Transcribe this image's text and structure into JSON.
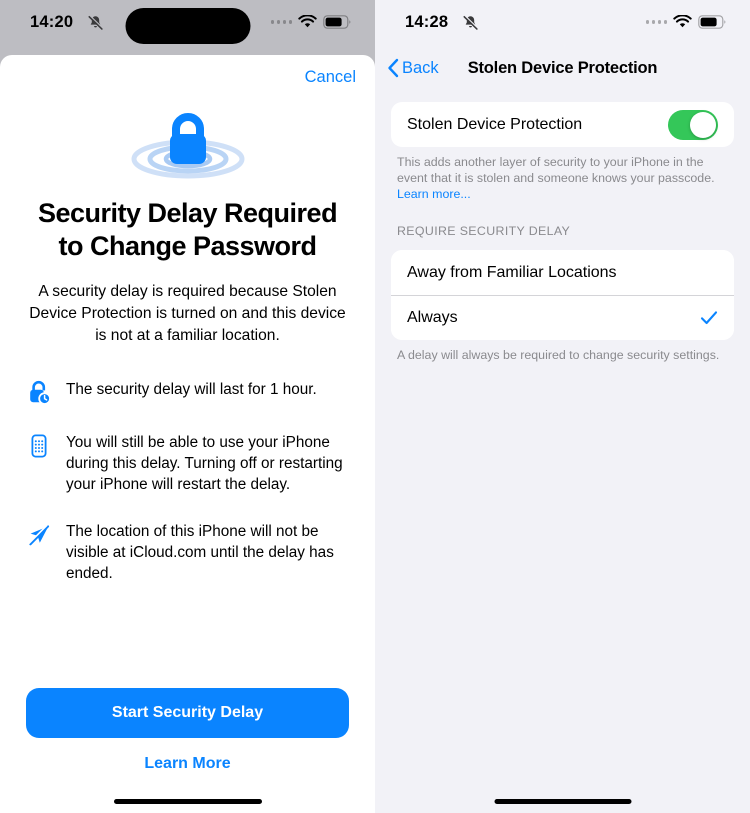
{
  "left": {
    "status": {
      "time": "14:20",
      "bell_icon": "bell-slash-icon",
      "wifi_icon": "wifi-icon",
      "battery_icon": "battery-icon"
    },
    "cancel_label": "Cancel",
    "hero_icon": "lock-ripple-icon",
    "title": "Security Delay Required to Change Password",
    "subtitle": "A security delay is required because Stolen Device Protection is turned on and this device is not at a familiar location.",
    "bullets": [
      {
        "icon": "lock-clock-icon",
        "text": "The security delay will last for 1 hour."
      },
      {
        "icon": "iphone-keypad-icon",
        "text": "You will still be able to use your iPhone during this delay. Turning off or restarting your iPhone will restart the delay."
      },
      {
        "icon": "location-slash-icon",
        "text": "The location of this iPhone will not be visible at iCloud.com until the delay has ended."
      }
    ],
    "primary_label": "Start Security Delay",
    "learn_more_label": "Learn More"
  },
  "right": {
    "status": {
      "time": "14:28",
      "bell_icon": "bell-slash-icon",
      "wifi_icon": "wifi-icon",
      "battery_icon": "battery-icon"
    },
    "back_label": "Back",
    "nav_title": "Stolen Device Protection",
    "toggle_row": {
      "label": "Stolen Device Protection",
      "state": "on"
    },
    "toggle_footnote": "This adds another layer of security to your iPhone in the event that it is stolen and someone knows your passcode. ",
    "learn_more_inline": "Learn more...",
    "section_header": "REQUIRE SECURITY DELAY",
    "options": [
      {
        "label": "Away from Familiar Locations",
        "selected": false
      },
      {
        "label": "Always",
        "selected": true
      }
    ],
    "options_footnote": "A delay will always be required to change security settings."
  },
  "colors": {
    "accent_blue": "#0A84FF",
    "toggle_green": "#34C759",
    "secondary_text": "#8A8A8E",
    "sheet_bg": "#FFFFFF",
    "settings_bg": "#F2F2F7"
  }
}
